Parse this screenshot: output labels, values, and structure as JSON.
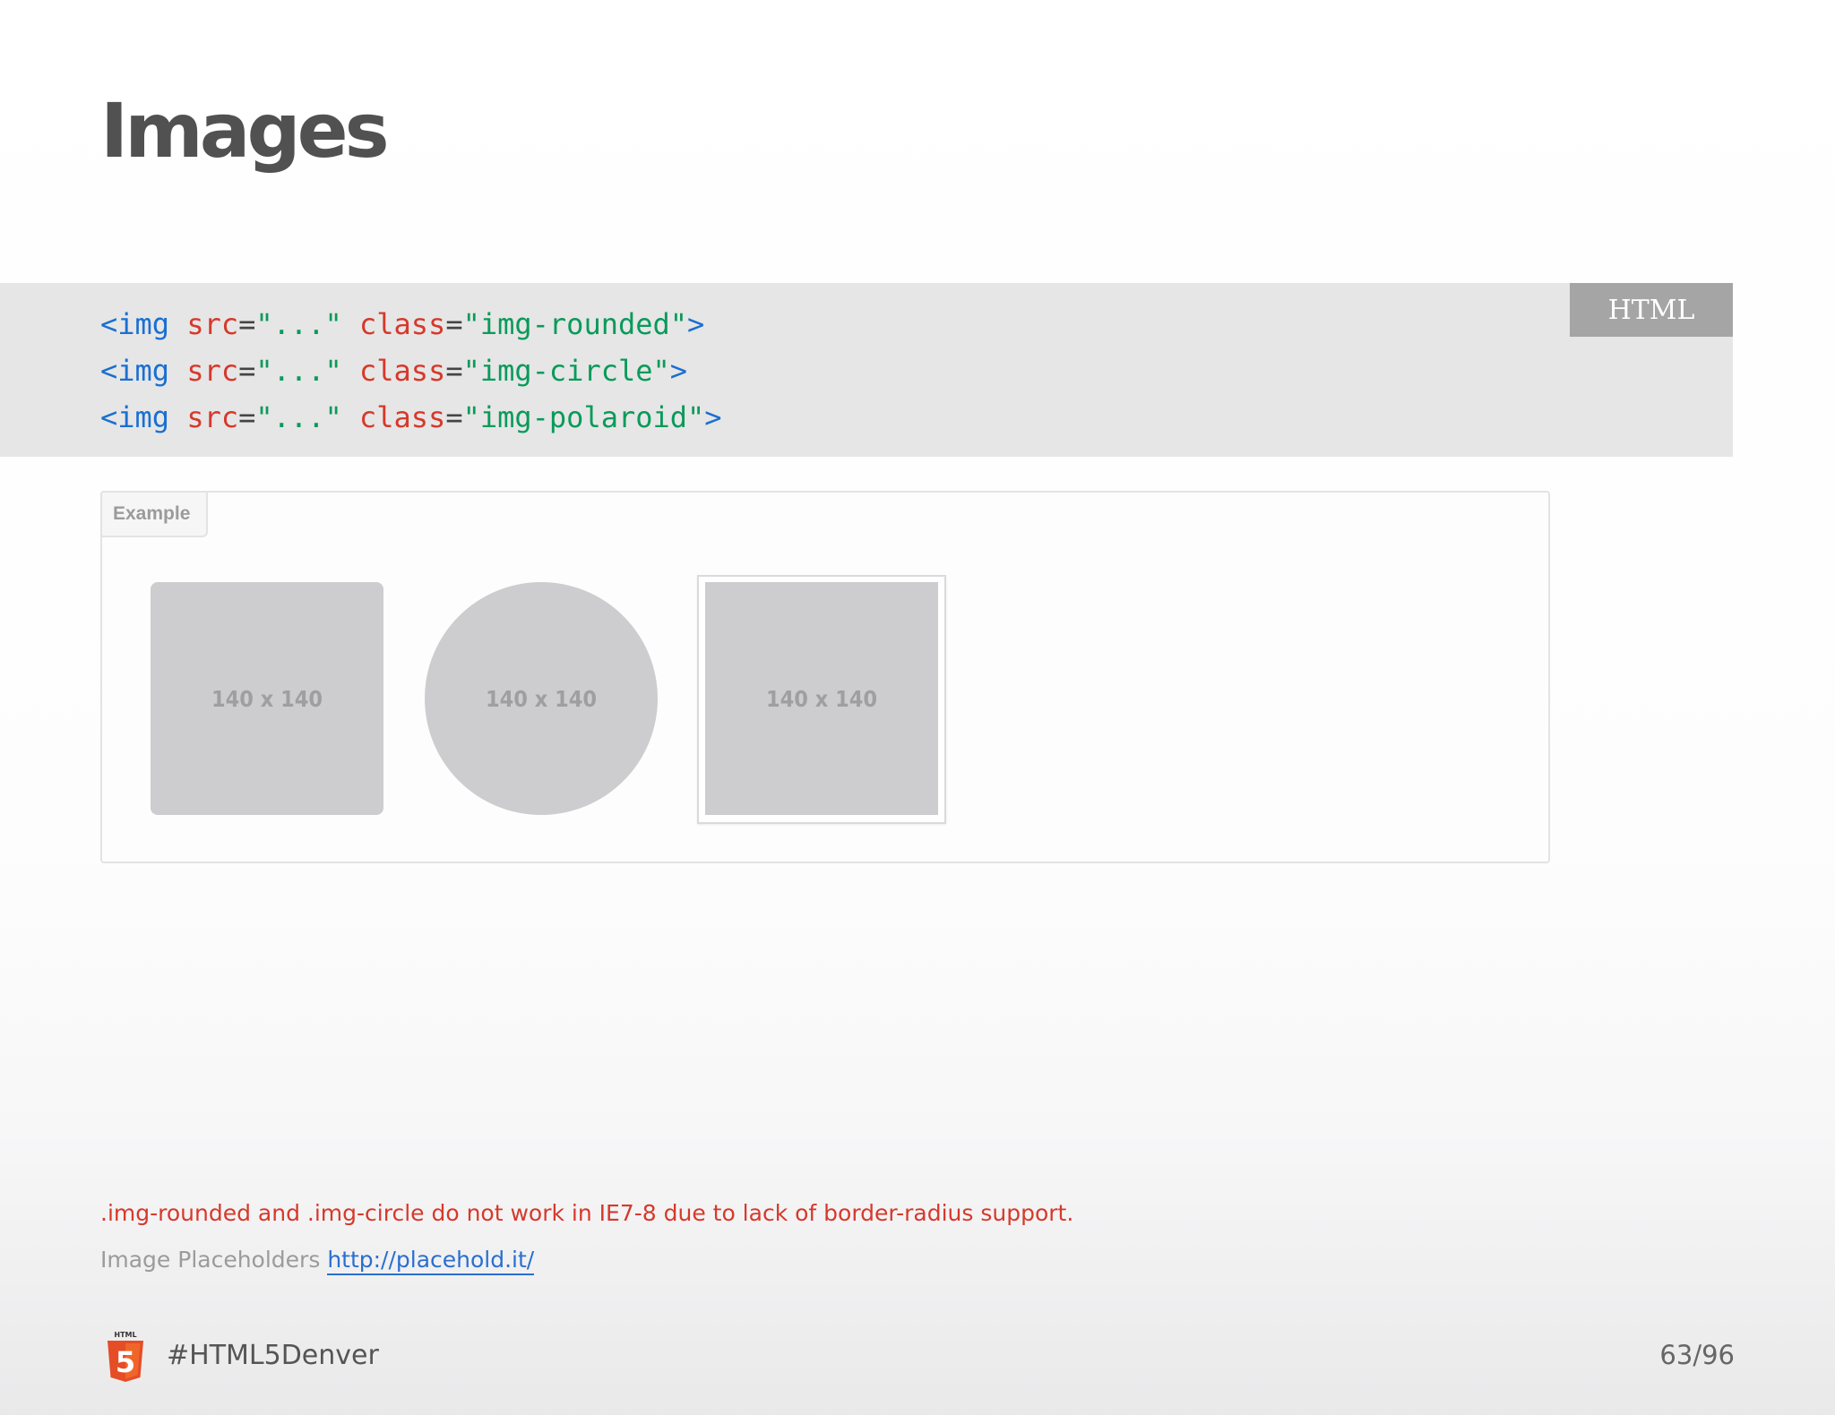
{
  "slide": {
    "title": "Images",
    "code": {
      "language_badge": "HTML",
      "lines": [
        [
          {
            "t": "tag",
            "v": "<img"
          },
          {
            "t": "space",
            "v": " "
          },
          {
            "t": "attr",
            "v": "src"
          },
          {
            "t": "eq",
            "v": "="
          },
          {
            "t": "val",
            "v": "\"...\""
          },
          {
            "t": "space",
            "v": " "
          },
          {
            "t": "attr",
            "v": "class"
          },
          {
            "t": "eq",
            "v": "="
          },
          {
            "t": "val",
            "v": "\"img-rounded\""
          },
          {
            "t": "tag",
            "v": ">"
          }
        ],
        [
          {
            "t": "tag",
            "v": "<img"
          },
          {
            "t": "space",
            "v": " "
          },
          {
            "t": "attr",
            "v": "src"
          },
          {
            "t": "eq",
            "v": "="
          },
          {
            "t": "val",
            "v": "\"...\""
          },
          {
            "t": "space",
            "v": " "
          },
          {
            "t": "attr",
            "v": "class"
          },
          {
            "t": "eq",
            "v": "="
          },
          {
            "t": "val",
            "v": "\"img-circle\""
          },
          {
            "t": "tag",
            "v": ">"
          }
        ],
        [
          {
            "t": "tag",
            "v": "<img"
          },
          {
            "t": "space",
            "v": " "
          },
          {
            "t": "attr",
            "v": "src"
          },
          {
            "t": "eq",
            "v": "="
          },
          {
            "t": "val",
            "v": "\"...\""
          },
          {
            "t": "space",
            "v": " "
          },
          {
            "t": "attr",
            "v": "class"
          },
          {
            "t": "eq",
            "v": "="
          },
          {
            "t": "val",
            "v": "\"img-polaroid\""
          },
          {
            "t": "tag",
            "v": ">"
          }
        ]
      ],
      "colors": {
        "tag": "#1a6fd1",
        "attr": "#d6392b",
        "value": "#0a9a5a",
        "background": "#e6e6e6"
      }
    },
    "example": {
      "tab_label": "Example",
      "placeholders": [
        {
          "style": "rounded",
          "label": "140 x 140"
        },
        {
          "style": "circle",
          "label": "140 x 140"
        },
        {
          "style": "polaroid",
          "label": "140 x 140"
        }
      ]
    },
    "notes": {
      "warning": ".img-rounded and .img-circle do not work in IE7-8 due to lack of border-radius support.",
      "placeholders_prefix": "Image Placeholders",
      "placeholders_link": "http://placehold.it/",
      "warning_color": "#d6392b",
      "link_color": "#2a6fcf"
    }
  },
  "footer": {
    "logo_icon": "html5-logo-icon",
    "logo_caption": "HTML",
    "logo_glyph": "5",
    "hashtag": "#HTML5Denver",
    "page_counter": "63/96"
  }
}
